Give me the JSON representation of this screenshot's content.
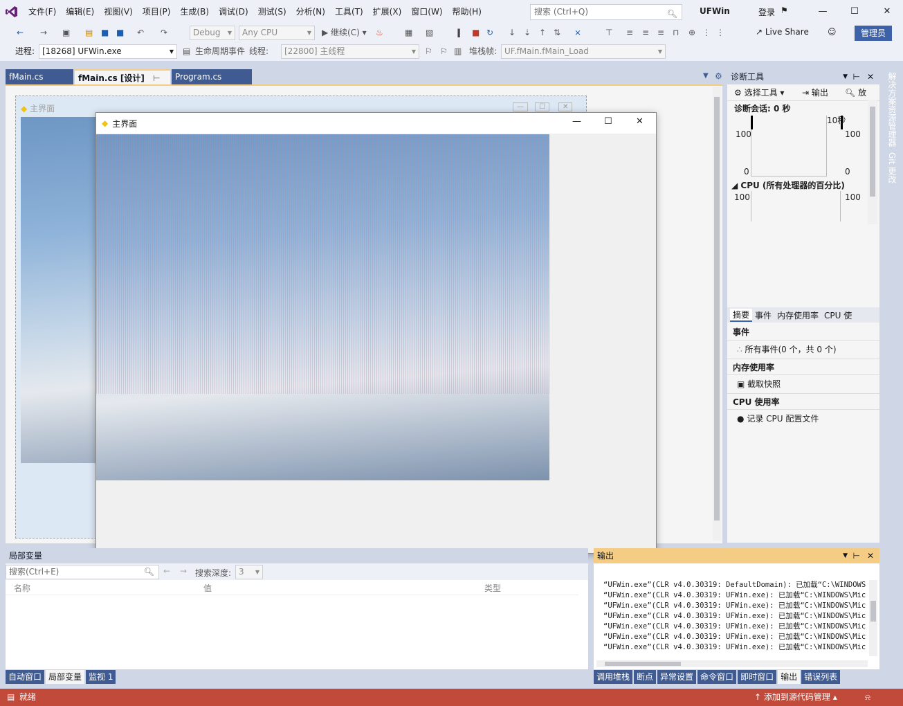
{
  "menu": [
    "文件(F)",
    "编辑(E)",
    "视图(V)",
    "项目(P)",
    "生成(B)",
    "调试(D)",
    "测试(S)",
    "分析(N)",
    "工具(T)",
    "扩展(X)",
    "窗口(W)",
    "帮助(H)"
  ],
  "search": {
    "placeholder": "搜索 (Ctrl+Q)"
  },
  "solution_name": "UFWin",
  "login": "登录",
  "toolbar": {
    "config": "Debug",
    "platform": "Any CPU",
    "continue": "继续(C)",
    "live_share": "Live Share",
    "admin": "管理员"
  },
  "debugbar": {
    "process_label": "进程:",
    "process": "[18268] UFWin.exe",
    "lifecycle": "生命周期事件",
    "thread_label": "线程:",
    "thread": "[22800] 主线程",
    "stack_label": "堆栈帧:",
    "stack": "UF.fMain.fMain_Load"
  },
  "doc_tabs": [
    {
      "label": "fMain.cs"
    },
    {
      "label": "fMain.cs [设计]"
    },
    {
      "label": "Program.cs"
    }
  ],
  "designer_form_title": "主界面",
  "running_form": {
    "title": "主界面"
  },
  "diag": {
    "title": "诊断工具",
    "select_tool": "选择工具",
    "output": "输出",
    "zoom": "放",
    "session": "诊断会话: 0 秒",
    "timeline_mark": "10秒",
    "axis_top": "100",
    "axis_bottom": "0",
    "cpu_header": "CPU (所有处理器的百分比)",
    "tabs": [
      "摘要",
      "事件",
      "内存使用率",
      "CPU 使"
    ],
    "events_header": "事件",
    "events_item": "所有事件(0 个，共 0 个)",
    "mem_header": "内存使用率",
    "mem_item": "截取快照",
    "cpu_usage_header": "CPU 使用率",
    "cpu_item": "记录 CPU 配置文件"
  },
  "side_tabs": [
    "解决方案资源管理器",
    "Git 更改"
  ],
  "locals": {
    "title": "局部变量",
    "search_placeholder": "搜索(Ctrl+E)",
    "depth_label": "搜索深度:",
    "depth": "3",
    "col_name": "名称",
    "col_value": "值",
    "col_type": "类型"
  },
  "bottom_left_tabs": [
    "自动窗口",
    "局部变量",
    "监视 1"
  ],
  "output": {
    "title": "输出",
    "lines": [
      "“UFWin.exe”(CLR v4.0.30319: DefaultDomain): 已加载“C:\\WINDOWS\\Mic",
      "“UFWin.exe”(CLR v4.0.30319: UFWin.exe): 已加载“C:\\WINDOWS\\Mic",
      "“UFWin.exe”(CLR v4.0.30319: UFWin.exe): 已加载“C:\\WINDOWS\\Mic",
      "“UFWin.exe”(CLR v4.0.30319: UFWin.exe): 已加载“C:\\WINDOWS\\Mic",
      "“UFWin.exe”(CLR v4.0.30319: UFWin.exe): 已加载“C:\\WINDOWS\\Mic",
      "“UFWin.exe”(CLR v4.0.30319: UFWin.exe): 已加载“C:\\WINDOWS\\Mic",
      "“UFWin.exe”(CLR v4.0.30319: UFWin.exe): 已加载“C:\\WINDOWS\\Mic"
    ]
  },
  "bottom_right_tabs": [
    "调用堆栈",
    "断点",
    "异常设置",
    "命令窗口",
    "即时窗口",
    "输出",
    "错误列表"
  ],
  "status": {
    "ready": "就绪",
    "source_control": "添加到源代码管理"
  }
}
